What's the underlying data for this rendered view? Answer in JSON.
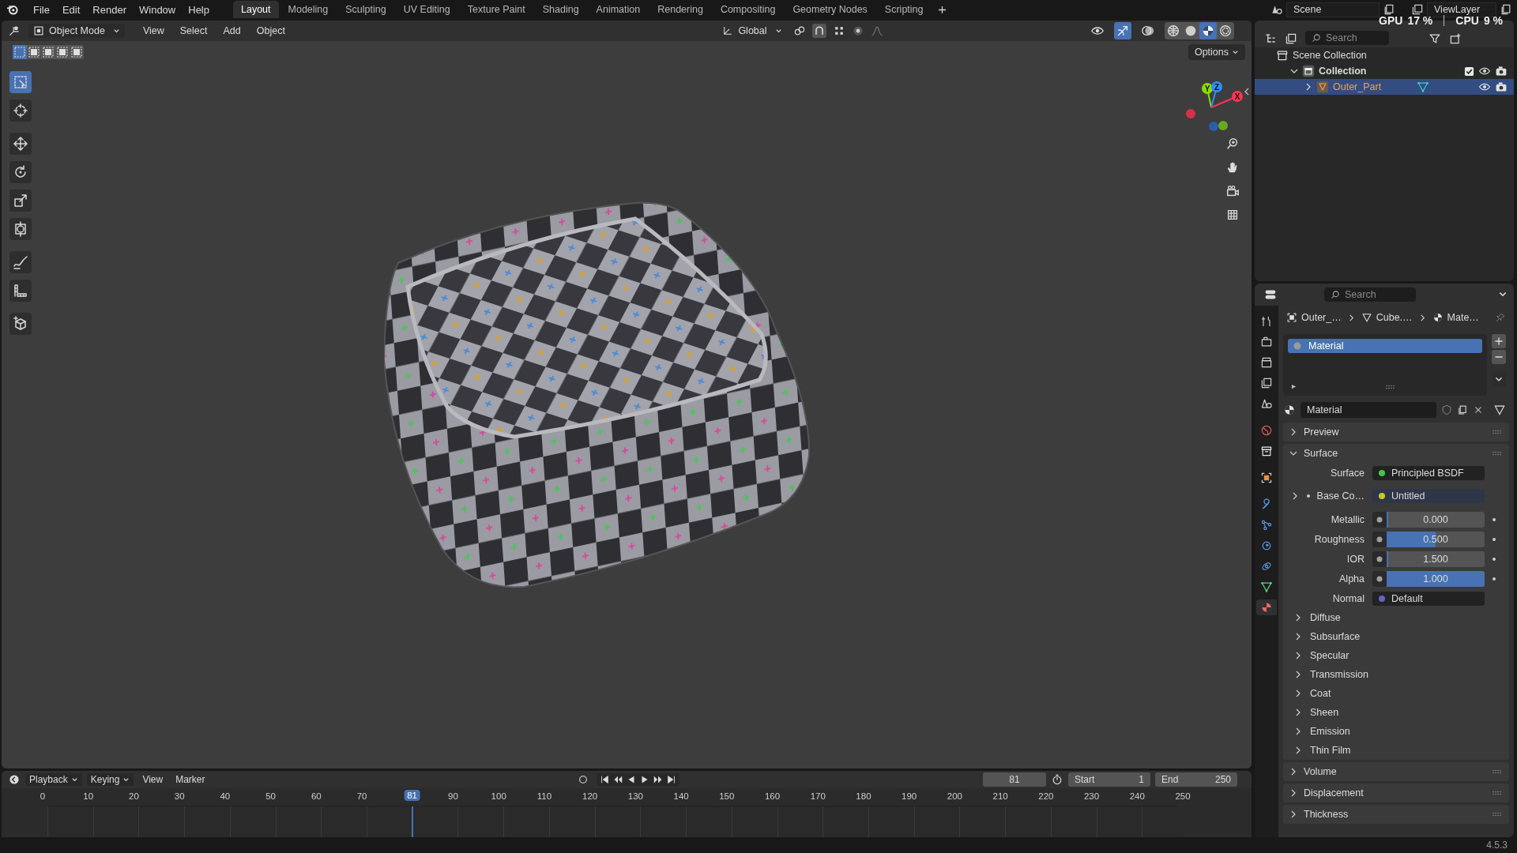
{
  "top_bar": {
    "menus": [
      "File",
      "Edit",
      "Render",
      "Window",
      "Help"
    ],
    "workspaces": [
      {
        "label": "Layout",
        "selected": true
      },
      {
        "label": "Modeling",
        "selected": false
      },
      {
        "label": "Sculpting",
        "selected": false
      },
      {
        "label": "UV Editing",
        "selected": false
      },
      {
        "label": "Texture Paint",
        "selected": false
      },
      {
        "label": "Shading",
        "selected": false
      },
      {
        "label": "Animation",
        "selected": false
      },
      {
        "label": "Rendering",
        "selected": false
      },
      {
        "label": "Compositing",
        "selected": false
      },
      {
        "label": "Geometry Nodes",
        "selected": false
      },
      {
        "label": "Scripting",
        "selected": false
      }
    ],
    "scene": "Scene",
    "view_layer": "ViewLayer",
    "gpu_label": "GPU",
    "gpu_value": "17 %",
    "cpu_label": "CPU",
    "cpu_value": "9 %"
  },
  "viewport": {
    "mode": "Object Mode",
    "menus": [
      "View",
      "Select",
      "Add",
      "Object"
    ],
    "orientation": "Global",
    "options": "Options",
    "select_modes": [
      {
        "selected": true
      },
      {
        "selected": false
      },
      {
        "selected": false
      },
      {
        "selected": false
      },
      {
        "selected": false
      }
    ],
    "toggles": [
      {
        "kind": "visibility",
        "on": false
      },
      {
        "kind": "gizmo",
        "on": true
      },
      {
        "kind": "overlay",
        "on": false
      }
    ],
    "shading_modes": [
      {
        "kind": "wireframe",
        "selected": false
      },
      {
        "kind": "solid",
        "selected": false
      },
      {
        "kind": "material",
        "selected": true
      },
      {
        "kind": "rendered",
        "selected": false
      }
    ],
    "tools": [
      {
        "kind": "select",
        "selected": true
      },
      {
        "kind": "cursor",
        "selected": false
      },
      {
        "kind": "move",
        "selected": false
      },
      {
        "kind": "rotate",
        "selected": false
      },
      {
        "kind": "scale",
        "selected": false
      },
      {
        "kind": "transform",
        "selected": false
      },
      {
        "kind": "annotate",
        "selected": false
      },
      {
        "kind": "measure",
        "selected": false
      },
      {
        "kind": "add-cube",
        "selected": false
      }
    ],
    "gizmo_axes": [
      {
        "label": "Y",
        "color": "#8bdc00"
      },
      {
        "label": "Z",
        "color": "#2c8fff"
      },
      {
        "label": "X",
        "color": "#ff3352"
      }
    ]
  },
  "outliner": {
    "search_placeholder": "Search",
    "items": [
      {
        "kind": "scene-collection",
        "label": "Scene Collection",
        "children": [
          {
            "kind": "collection",
            "label": "Collection",
            "expanded": true,
            "checked": true,
            "children": [
              {
                "kind": "object",
                "label": "Outer_Part",
                "expanded": false,
                "selected": true
              }
            ]
          }
        ]
      }
    ]
  },
  "properties": {
    "search_placeholder": "Search",
    "tabs": [
      {
        "kind": "tool",
        "selected": false
      },
      {
        "kind": "render",
        "selected": false
      },
      {
        "kind": "output",
        "selected": false
      },
      {
        "kind": "view-layer",
        "selected": false
      },
      {
        "kind": "scene",
        "selected": false
      },
      {
        "kind": "world",
        "selected": false
      },
      {
        "kind": "collection",
        "selected": false
      },
      {
        "kind": "object",
        "selected": false
      },
      {
        "kind": "modifiers",
        "selected": false
      },
      {
        "kind": "particles",
        "selected": false
      },
      {
        "kind": "physics",
        "selected": false
      },
      {
        "kind": "constraints",
        "selected": false
      },
      {
        "kind": "data",
        "selected": false
      },
      {
        "kind": "material",
        "selected": true
      }
    ],
    "breadcrumb": [
      {
        "kind": "object",
        "label": "Outer_…"
      },
      {
        "kind": "mesh",
        "label": "Cube.…"
      },
      {
        "kind": "material",
        "label": "Mate…"
      }
    ],
    "slots": [
      {
        "label": "Material",
        "selected": true
      }
    ],
    "material_name": "Material",
    "panels": [
      {
        "label": "Preview",
        "expanded": false
      },
      {
        "label": "Surface",
        "expanded": true,
        "fields": [
          {
            "kind": "link",
            "label": "Surface",
            "value": "Principled BSDF",
            "color": "#3fc54a"
          },
          {
            "kind": "link",
            "label": "Base Co…",
            "value": "Untitled",
            "color": "#c7c729",
            "expandable": true
          },
          {
            "kind": "slider",
            "label": "Metallic",
            "value": "0.000",
            "level": 0
          },
          {
            "kind": "slider",
            "label": "Roughness",
            "value": "0.500",
            "level": 0.5
          },
          {
            "kind": "slider",
            "label": "IOR",
            "value": "1.500",
            "level": 0
          },
          {
            "kind": "slider",
            "label": "Alpha",
            "value": "1.000",
            "level": 1
          },
          {
            "kind": "link",
            "label": "Normal",
            "value": "Default",
            "color": "#6363c7"
          }
        ],
        "subpanels": [
          {
            "label": "Diffuse",
            "expanded": false
          },
          {
            "label": "Subsurface",
            "expanded": false
          },
          {
            "label": "Specular",
            "expanded": false
          },
          {
            "label": "Transmission",
            "expanded": false
          },
          {
            "label": "Coat",
            "expanded": false
          },
          {
            "label": "Sheen",
            "expanded": false
          },
          {
            "label": "Emission",
            "expanded": false
          },
          {
            "label": "Thin Film",
            "expanded": false
          }
        ]
      },
      {
        "label": "Volume",
        "expanded": false
      },
      {
        "label": "Displacement",
        "expanded": false
      },
      {
        "label": "Thickness",
        "expanded": false
      }
    ]
  },
  "timeline": {
    "menus": [
      "Playback",
      "Keying",
      "View",
      "Marker"
    ],
    "current_frame": "81",
    "start_label": "Start",
    "start": "1",
    "end_label": "End",
    "end": "250",
    "ruler": [
      "0",
      "10",
      "20",
      "30",
      "40",
      "50",
      "60",
      "70",
      "90",
      "100",
      "110",
      "120",
      "130",
      "140",
      "150",
      "160",
      "170",
      "180",
      "190",
      "200",
      "210",
      "220",
      "230",
      "240",
      "250"
    ],
    "playhead": "81"
  },
  "status_bar": {
    "version": "4.5.3"
  }
}
